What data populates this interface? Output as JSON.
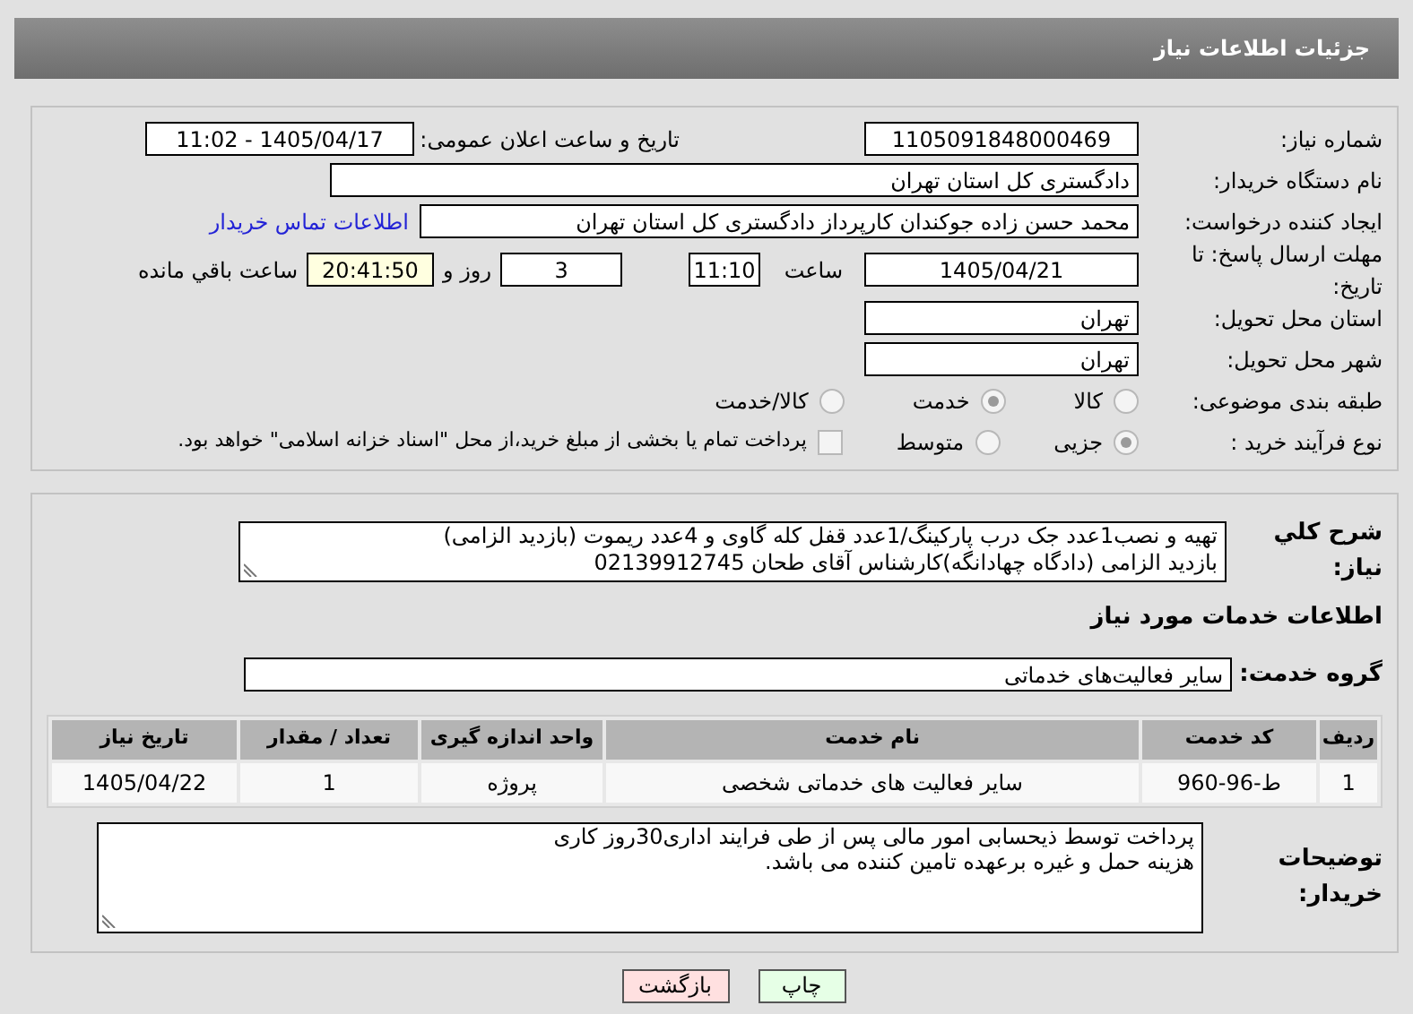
{
  "header": {
    "title": "جزئیات اطلاعات نیاز"
  },
  "need_number": {
    "label": "شماره نیاز:",
    "value": "1105091848000469"
  },
  "announce": {
    "label": "تاریخ و ساعت اعلان عمومی:",
    "value": "1405/04/17 - 11:02"
  },
  "buyer": {
    "label": "نام دستگاه خریدار:",
    "value": "دادگستری کل استان تهران"
  },
  "creator": {
    "label": "ایجاد کننده درخواست:",
    "value": "محمد حسن زاده جوکندان کارپرداز دادگستری کل استان تهران",
    "link": "اطلاعات تماس خریدار"
  },
  "deadline": {
    "label": "مهلت ارسال پاسخ: تا تاریخ:",
    "date": "1405/04/21",
    "time_label": "ساعت",
    "time": "11:10",
    "days": "3",
    "days_label": "روز و",
    "remaining": "20:41:50",
    "remaining_label": "ساعت باقي مانده"
  },
  "province": {
    "label": "استان محل تحویل:",
    "value": "تهران"
  },
  "city": {
    "label": "شهر محل تحویل:",
    "value": "تهران"
  },
  "category": {
    "label": "طبقه بندی موضوعی:",
    "options": [
      {
        "label": "کالا",
        "selected": false
      },
      {
        "label": "خدمت",
        "selected": true
      },
      {
        "label": "کالا/خدمت",
        "selected": false
      }
    ]
  },
  "process": {
    "label": "نوع فرآیند خرید :",
    "options": [
      {
        "label": "جزیی",
        "selected": true
      },
      {
        "label": "متوسط",
        "selected": false
      }
    ],
    "treasury": {
      "label": "پرداخت تمام یا بخشی از مبلغ خرید،از محل \"اسناد خزانه اسلامی\" خواهد بود.",
      "checked": false
    }
  },
  "description": {
    "label": "شرح کلي نیاز:",
    "lines": [
      "تهیه و نصب1عدد جک درب پارکینگ/1عدد قفل کله گاوی و 4عدد ریموت (بازدید الزامی)",
      "بازدید الزامی (دادگاه چهادانگه)کارشناس آقای طحان 02139912745"
    ]
  },
  "services_heading": "اطلاعات خدمات مورد نیاز",
  "service_group": {
    "label": "گروه خدمت:",
    "value": "سایر فعالیت‌های خدماتی"
  },
  "table": {
    "columns": [
      "ردیف",
      "کد خدمت",
      "نام خدمت",
      "واحد اندازه گیری",
      "تعداد / مقدار",
      "تاریخ نیاز"
    ],
    "rows": [
      [
        "1",
        "ط-96-960",
        "سایر فعالیت های خدماتی شخصی",
        "پروژه",
        "1",
        "1405/04/22"
      ]
    ]
  },
  "buyer_notes": {
    "label": "توضیحات خریدار:",
    "lines": [
      "پرداخت توسط ذیحسابی امور مالی پس از طی فرایند اداری30روز کاری",
      "هزینه حمل و غیره برعهده تامین کننده می باشد."
    ]
  },
  "buttons": [
    {
      "label": "چاپ",
      "kind": "print"
    },
    {
      "label": "بازگشت",
      "kind": "back"
    }
  ]
}
